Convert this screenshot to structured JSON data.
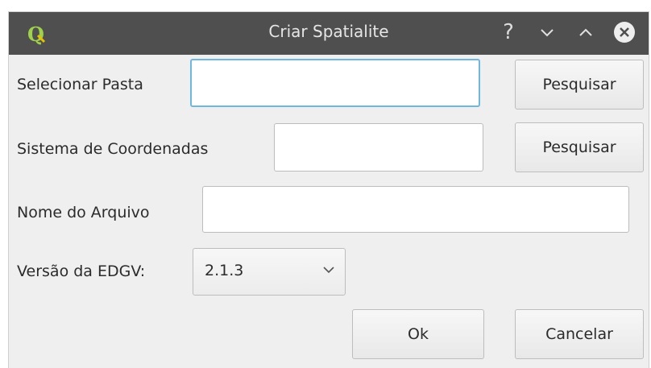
{
  "window": {
    "title": "Criar Spatialite",
    "help_glyph": "?",
    "logo_letter": "Q"
  },
  "form": {
    "folder": {
      "label": "Selecionar Pasta",
      "value": "",
      "button": "Pesquisar"
    },
    "crs": {
      "label": "Sistema de Coordenadas",
      "value": "",
      "button": "Pesquisar"
    },
    "filename": {
      "label": "Nome do Arquivo",
      "value": ""
    },
    "edgv": {
      "label": "Versão da EDGV:",
      "selected": "2.1.3"
    }
  },
  "actions": {
    "ok": "Ok",
    "cancel": "Cancelar"
  },
  "colors": {
    "titlebar": "#4f4f4f",
    "focus": "#6fb7e3",
    "logo": "#8cc63f"
  },
  "icons": [
    "qgis-logo-icon",
    "help-icon",
    "minimize-icon",
    "maximize-icon",
    "close-icon",
    "chevron-down-icon"
  ]
}
